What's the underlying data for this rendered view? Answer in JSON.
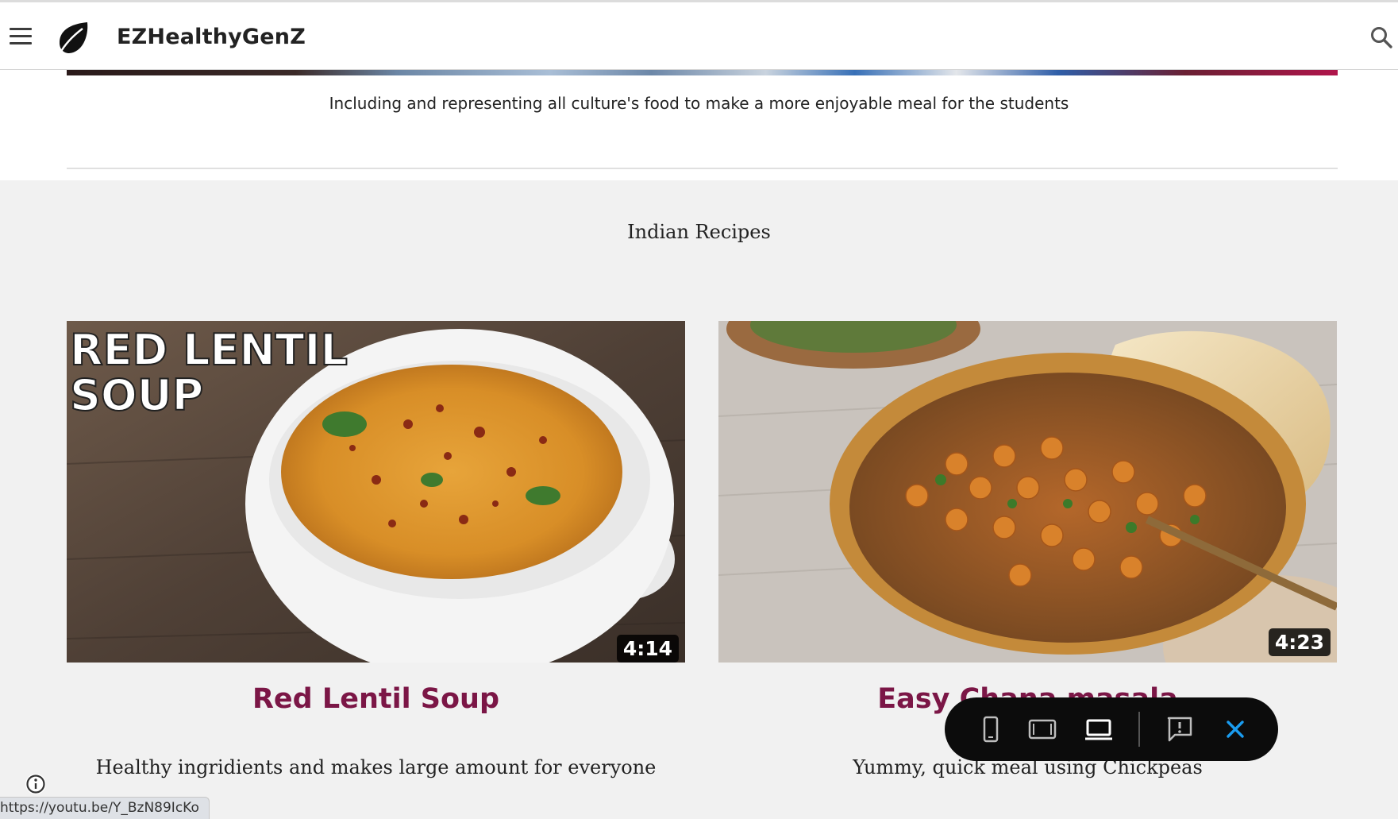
{
  "header": {
    "site_title": "EZHealthyGenZ",
    "menu_icon": "hamburger-menu-icon",
    "logo_icon": "leaf-icon",
    "search_icon": "search-icon"
  },
  "intro": {
    "caption": "Including and representing all culture's food to make a more enjoyable meal for the students"
  },
  "section": {
    "title": "Indian Recipes"
  },
  "cards": [
    {
      "thumbnail_text_line1": "RED LENTIL",
      "thumbnail_text_line2": "SOUP",
      "duration": "4:14",
      "title": "Red Lentil Soup",
      "description": "Healthy ingridients and makes large amount for everyone"
    },
    {
      "duration": "4:23",
      "title": "Easy Chana masala",
      "title_visible": "Eas",
      "description": "Yummy, quick meal using Chickpeas"
    }
  ],
  "preview_toolbar": {
    "buttons": [
      "phone-view-icon",
      "tablet-view-icon",
      "laptop-view-icon",
      "report-abuse-icon",
      "close-icon"
    ],
    "active": "laptop-view-icon",
    "close_color": "#1a9cf0"
  },
  "status_bar": {
    "url": "https://youtu.be/Y_BzN89IcKo"
  },
  "colors": {
    "accent": "#7b1646",
    "page_background": "#f1f1f1"
  }
}
